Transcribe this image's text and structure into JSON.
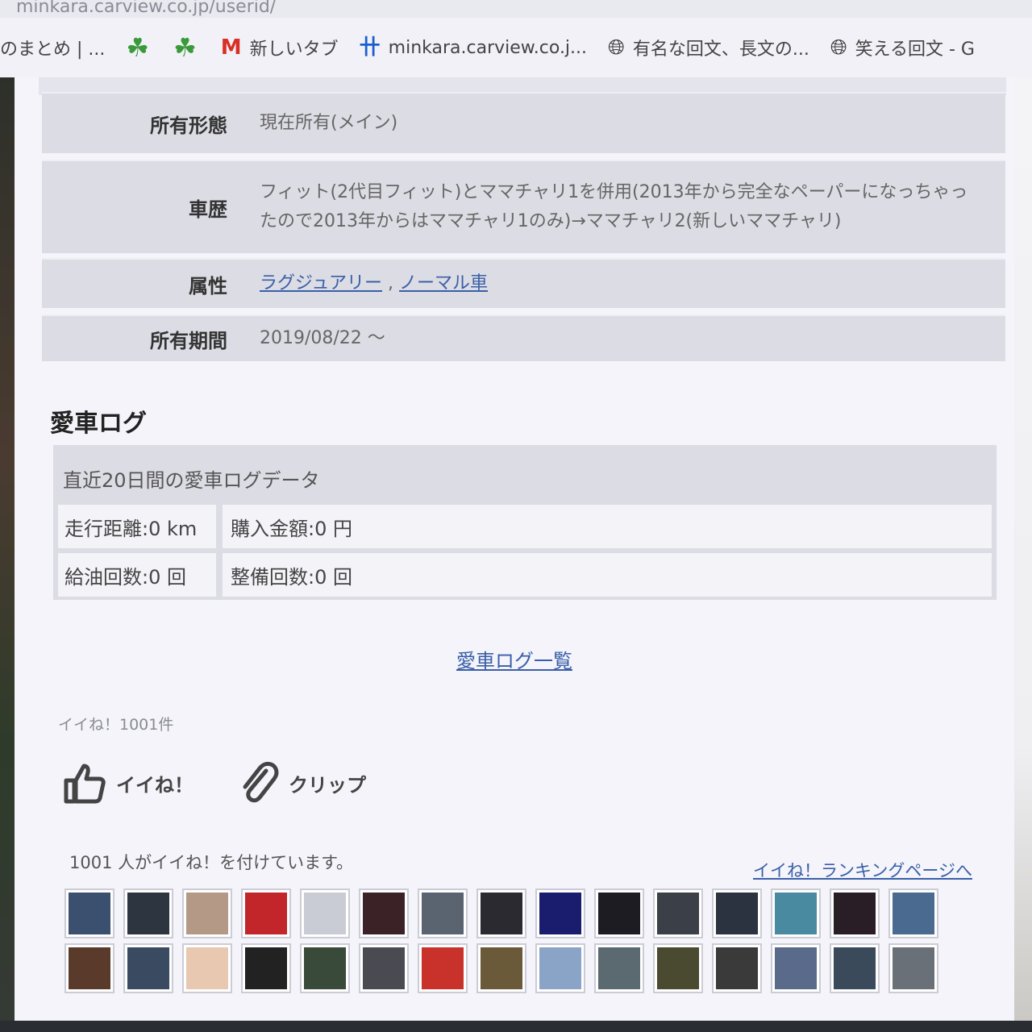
{
  "browser": {
    "url_partial": "minkara.carview.co.jp/userid/",
    "bookmarks": [
      {
        "icon": "text",
        "label": "のまとめ | ..."
      },
      {
        "icon": "clover-icon",
        "label": ""
      },
      {
        "icon": "clover-icon",
        "label": ""
      },
      {
        "icon": "gmail-icon",
        "label": "新しいタブ"
      },
      {
        "icon": "minkara-icon",
        "label": "minkara.carview.co.j..."
      },
      {
        "icon": "globe-icon",
        "label": "有名な回文、長文の..."
      },
      {
        "icon": "globe-icon",
        "label": "笑える回文 - G"
      }
    ]
  },
  "spec": {
    "ownership_label": "所有形態",
    "ownership_value": "現在所有(メイン)",
    "history_label": "車歴",
    "history_value_line1": "フィット(2代目フィット)とママチャリ1を併用(2013年から完全なペーパーになっちゃっ",
    "history_value_line2": "たので2013年からはママチャリ1のみ)→ママチャリ2(新しいママチャリ)",
    "attribute_label": "属性",
    "attribute_link1": "ラグジュアリー",
    "attribute_sep": ",",
    "attribute_link2": "ノーマル車",
    "period_label": "所有期間",
    "period_value": "2019/08/22 〜"
  },
  "car_log": {
    "title": "愛車ログ",
    "subtitle": "直近20日間の愛車ログデータ",
    "distance": "走行距離:0 km",
    "purchase": "購入金額:0 円",
    "refuel": "給油回数:0 回",
    "maintenance": "整備回数:0 回",
    "list_link": "愛車ログ一覧"
  },
  "likes": {
    "count_text": "イイね！1001件",
    "like_button": "イイね！",
    "clip_button": "クリップ",
    "likers_text": "1001 人がイイね！を付けています。",
    "ranking_link": "イイね！ランキングページへ"
  },
  "thumbnails": {
    "row1": [
      "#3b4f6e",
      "#2d3540",
      "#b49a86",
      "#c2262a",
      "#c9ccd4",
      "#3a2226",
      "#5a6470",
      "#2a2a30",
      "#1a1d6e",
      "#1c1c22",
      "#3a3f48",
      "#2c3340",
      "#4a8aa0",
      "#2a1e26",
      "#4a6a90"
    ],
    "row2": [
      "#5a3a2a",
      "#3a4a60",
      "#e8c8b0",
      "#222222",
      "#3a4a3a",
      "#4a4a52",
      "#c8322a",
      "#6a5a3a",
      "#8aa4c8",
      "#5a6a70",
      "#4a4a30",
      "#3a3a3a",
      "#5a6a8a",
      "#3a4a5a",
      "#6a7078"
    ]
  }
}
